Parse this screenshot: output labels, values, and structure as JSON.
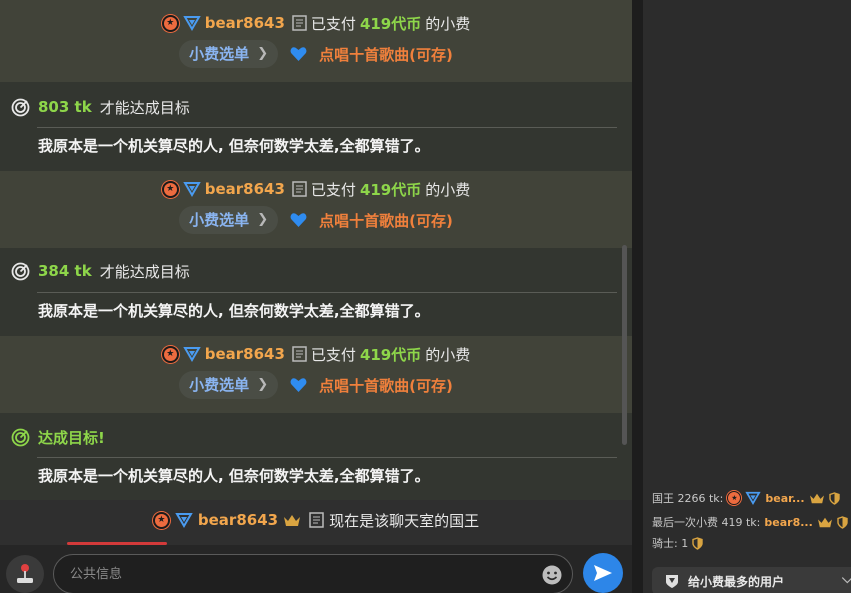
{
  "chat": {
    "tips": [
      {
        "user": "bear8643",
        "text_prefix": "已支付",
        "amount": "419代币",
        "text_suffix": "的小费",
        "menu_label": "小费选单",
        "song": "点唱十首歌曲(可存)"
      },
      {
        "user": "bear8643",
        "text_prefix": "已支付",
        "amount": "419代币",
        "text_suffix": "的小费",
        "menu_label": "小费选单",
        "song": "点唱十首歌曲(可存)"
      },
      {
        "user": "bear8643",
        "text_prefix": "已支付",
        "amount": "419代币",
        "text_suffix": "的小费",
        "menu_label": "小费选单",
        "song": "点唱十首歌曲(可存)"
      }
    ],
    "goals": [
      {
        "tk": "803 tk",
        "label": "才能达成目标",
        "desc": "我原本是一个机关算尽的人, 但奈何数学太差,全都算错了。"
      },
      {
        "tk": "384 tk",
        "label": "才能达成目标",
        "desc": "我原本是一个机关算尽的人, 但奈何数学太差,全都算错了。"
      },
      {
        "tk": "达成目标!",
        "label": "",
        "desc": "我原本是一个机关算尽的人, 但奈何数学太差,全都算错了。"
      }
    ],
    "king": {
      "user": "bear8643",
      "text": "现在是该聊天室的国王"
    }
  },
  "input": {
    "placeholder": "公共信息"
  },
  "side": {
    "king_label": "国王 2266 tk:",
    "king_user": "bear...",
    "last_tip_label": "最后一次小费 419 tk:",
    "last_tip_user": "bear8...",
    "knight_label": "骑士: 1",
    "top_tipper": "给小费最多的用户"
  },
  "colors": {
    "accent_green": "#8ed64a",
    "username_orange": "#f2a64d",
    "menu_blue": "#8ab4f0",
    "song_orange": "#f0803c",
    "send_blue": "#2d86e8"
  }
}
